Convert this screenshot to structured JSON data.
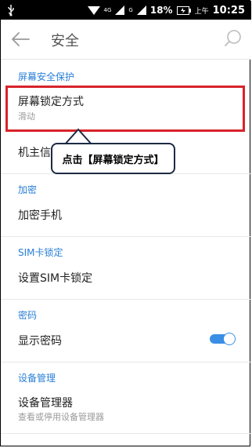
{
  "status_bar": {
    "network_4g": "4G",
    "network_g": "G",
    "battery": "18%",
    "ampm": "上午",
    "time": "10:25"
  },
  "app_bar": {
    "title": "安全"
  },
  "sections": {
    "screen_protection": {
      "header": "屏幕安全保护",
      "lock_title": "屏幕锁定方式",
      "lock_value": "滑动",
      "owner_info": "机主信息"
    },
    "encryption": {
      "header": "加密",
      "encrypt_phone": "加密手机"
    },
    "sim_lock": {
      "header": "SIM卡锁定",
      "set_sim_lock": "设置SIM卡锁定"
    },
    "password": {
      "header": "密码",
      "show_password": "显示密码",
      "show_password_on": true
    },
    "device_admin": {
      "header": "设备管理",
      "device_admins": "设备管理器",
      "device_admins_sub": "查看或停用设备管理器"
    }
  },
  "annotation": {
    "callout_text": "点击【屏幕锁定方式】"
  },
  "colors": {
    "accent": "#2a7fd6",
    "highlight": "#d8232a",
    "toggle_on": "#3a8ee6"
  }
}
